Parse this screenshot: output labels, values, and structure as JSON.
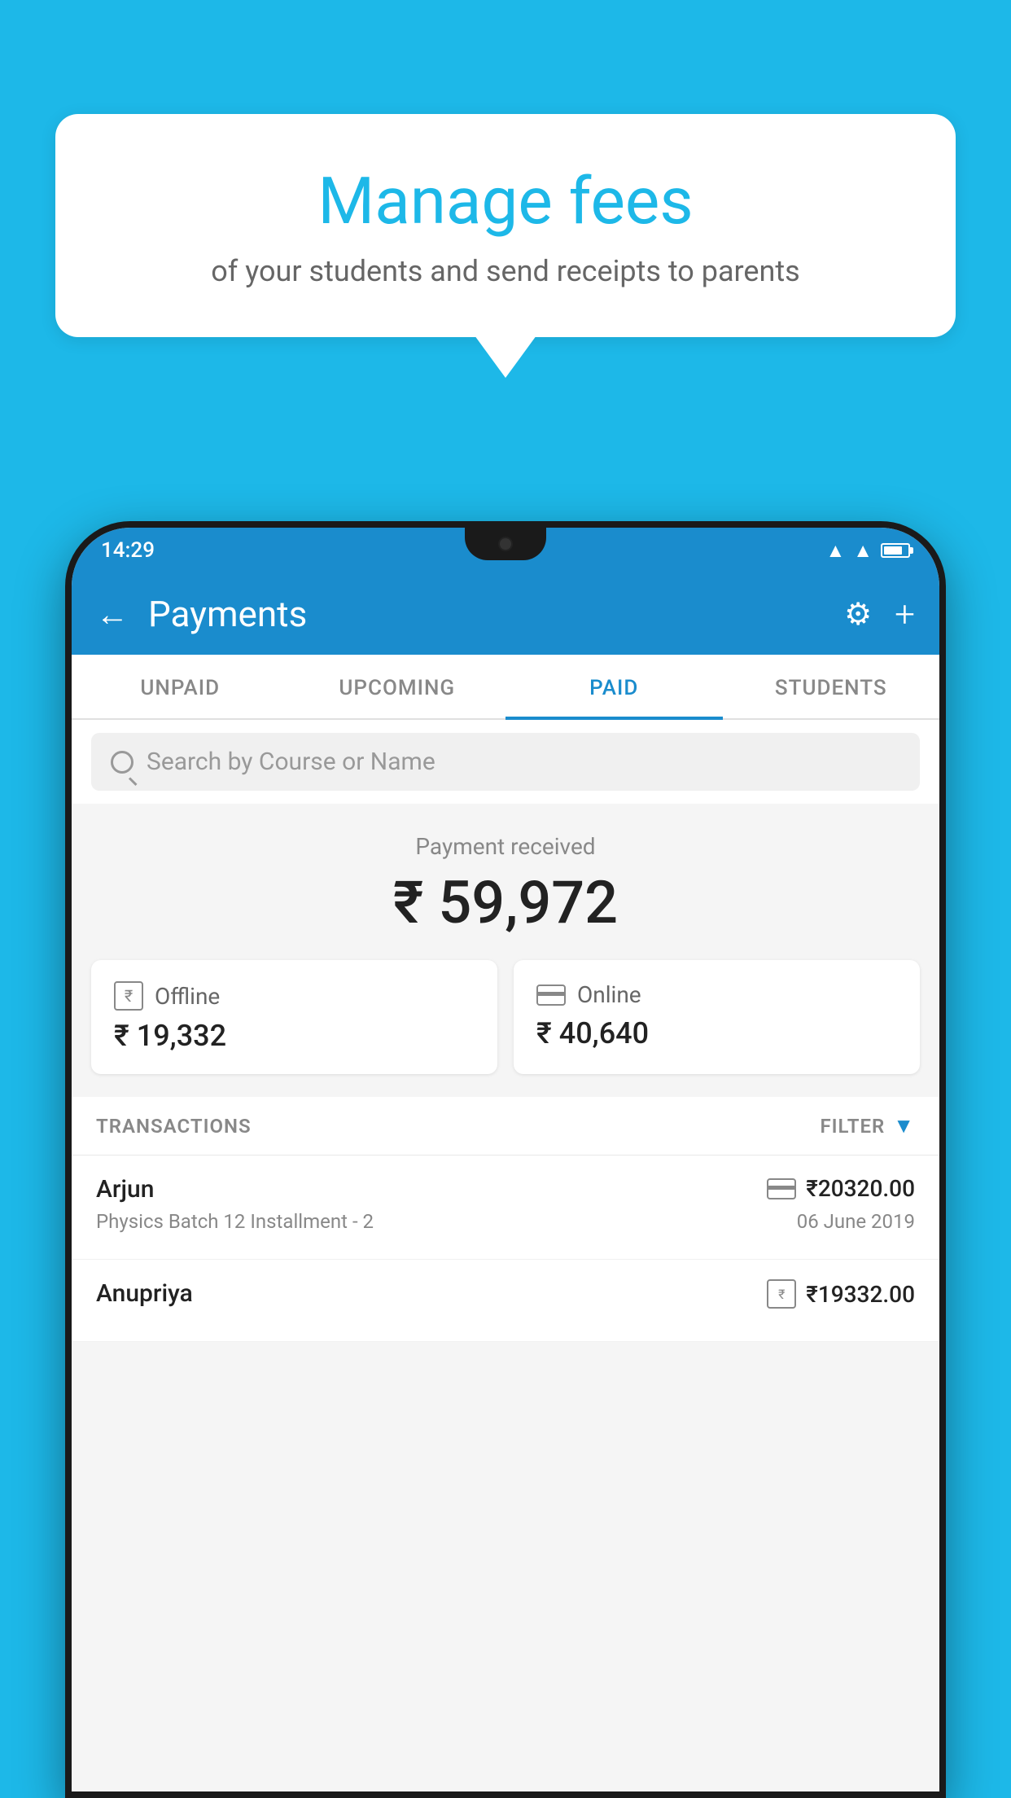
{
  "background_color": "#1db8e8",
  "speech_bubble": {
    "heading": "Manage fees",
    "subtext": "of your students and send receipts to parents"
  },
  "status_bar": {
    "time": "14:29",
    "wifi": "▲",
    "signal": "▲",
    "battery": "battery"
  },
  "app_bar": {
    "title": "Payments",
    "back_label": "←",
    "settings_label": "⚙",
    "add_label": "+"
  },
  "tabs": [
    {
      "id": "unpaid",
      "label": "UNPAID",
      "active": false
    },
    {
      "id": "upcoming",
      "label": "UPCOMING",
      "active": false
    },
    {
      "id": "paid",
      "label": "PAID",
      "active": true
    },
    {
      "id": "students",
      "label": "STUDENTS",
      "active": false
    }
  ],
  "search": {
    "placeholder": "Search by Course or Name"
  },
  "payment_summary": {
    "label": "Payment received",
    "amount": "₹ 59,972",
    "offline": {
      "label": "Offline",
      "amount": "₹ 19,332"
    },
    "online": {
      "label": "Online",
      "amount": "₹ 40,640"
    }
  },
  "transactions": {
    "header_label": "TRANSACTIONS",
    "filter_label": "FILTER",
    "items": [
      {
        "name": "Arjun",
        "course": "Physics Batch 12 Installment - 2",
        "amount": "₹20320.00",
        "date": "06 June 2019",
        "payment_type": "online"
      },
      {
        "name": "Anupriya",
        "course": "",
        "amount": "₹19332.00",
        "date": "",
        "payment_type": "offline"
      }
    ]
  }
}
